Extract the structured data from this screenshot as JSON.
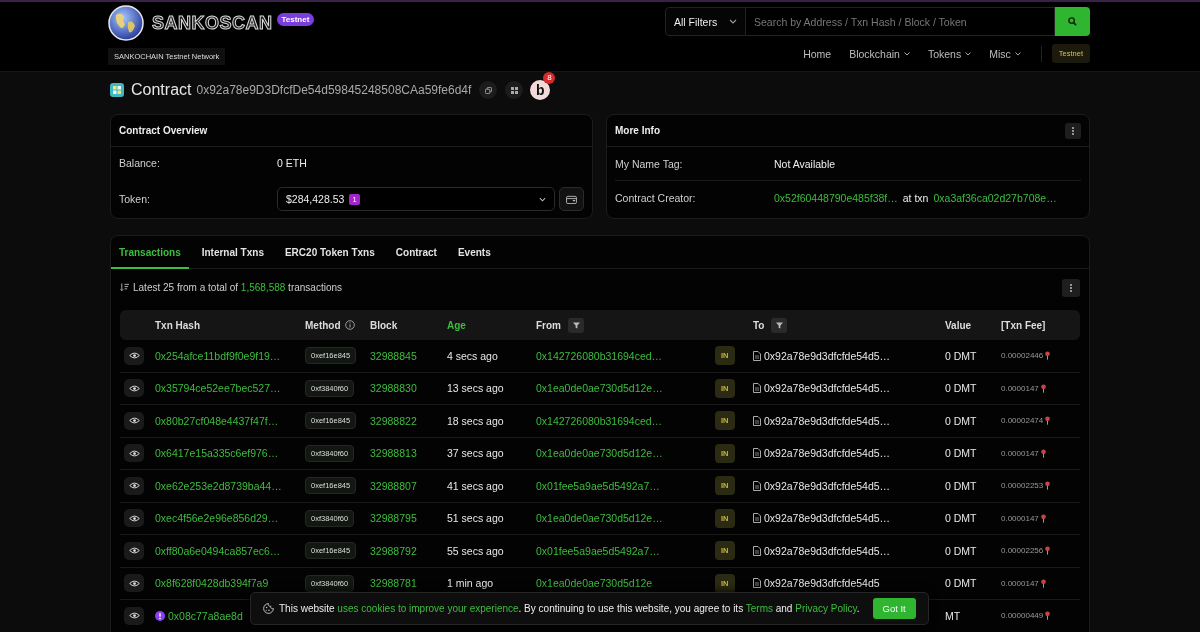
{
  "header": {
    "brand": "SANKOSCAN",
    "brand_badge": "Testnet",
    "network": "SANKOCHAIN Testnet Network",
    "search": {
      "filter": "All Filters",
      "placeholder": "Search by Address / Txn Hash / Block / Token"
    },
    "nav": [
      {
        "label": "Home",
        "kind": "link"
      },
      {
        "label": "Blockchain",
        "kind": "dropdown"
      },
      {
        "label": "Tokens",
        "kind": "dropdown"
      },
      {
        "label": "Misc",
        "kind": "dropdown"
      }
    ],
    "network_button": "Testnet"
  },
  "contract": {
    "title": "Contract",
    "address": "0x92a78e9D3DfcfDe54d59845248508CAa59fe6d4f",
    "avatar_letter": "b",
    "avatar_badge": "8"
  },
  "overview": {
    "title": "Contract Overview",
    "balance_label": "Balance:",
    "balance": "0 ETH",
    "token_label": "Token:",
    "token_value": "$284,428.53",
    "token_count": "1"
  },
  "more_info": {
    "title": "More Info",
    "name_tag_label": "My Name Tag:",
    "name_tag": "Not Available",
    "creator_label": "Contract Creator:",
    "creator": "0x52f60448790e485f38f…",
    "at_txn": "at txn",
    "creator_txn": "0xa3af36ca02d27b708e…"
  },
  "tabs": [
    {
      "label": "Transactions",
      "selected": true
    },
    {
      "label": "Internal Txns",
      "selected": false
    },
    {
      "label": "ERC20 Token Txns",
      "selected": false
    },
    {
      "label": "Contract",
      "selected": false
    },
    {
      "label": "Events",
      "selected": false
    }
  ],
  "summary": {
    "before": "Latest 25 from a total of ",
    "link": "1,568,588",
    "after": " transactions"
  },
  "table": {
    "columns": [
      {
        "label": "Txn Hash",
        "kind": "plain"
      },
      {
        "label": "Method",
        "kind": "info"
      },
      {
        "label": "Block",
        "kind": "plain"
      },
      {
        "label": "Age",
        "kind": "link"
      },
      {
        "label": "From",
        "kind": "filter"
      },
      {
        "label": "To",
        "kind": "filter"
      },
      {
        "label": "Value",
        "kind": "plain"
      },
      {
        "label": "[Txn Fee]",
        "kind": "plain"
      }
    ],
    "rows": [
      {
        "warning": false,
        "hash": "0x254afce11bdf9f0e9f19…",
        "method": "0xef16e845",
        "block": "32988845",
        "age": "4 secs ago",
        "from": "0x142726080b31694ced…",
        "direction": "IN",
        "to": "0x92a78e9d3dfcfde54d5…",
        "value": "0 DMT",
        "fee": "0.00002446"
      },
      {
        "warning": false,
        "hash": "0x35794ce52ee7bec527…",
        "method": "0xf3840f60",
        "block": "32988830",
        "age": "13 secs ago",
        "from": "0x1ea0de0ae730d5d12e…",
        "direction": "IN",
        "to": "0x92a78e9d3dfcfde54d5…",
        "value": "0 DMT",
        "fee": "0.0000147"
      },
      {
        "warning": false,
        "hash": "0x80b27cf048e4437f47f…",
        "method": "0xef16e845",
        "block": "32988822",
        "age": "18 secs ago",
        "from": "0x142726080b31694ced…",
        "direction": "IN",
        "to": "0x92a78e9d3dfcfde54d5…",
        "value": "0 DMT",
        "fee": "0.00002474"
      },
      {
        "warning": false,
        "hash": "0x6417e15a335c6ef976…",
        "method": "0xf3840f60",
        "block": "32988813",
        "age": "37 secs ago",
        "from": "0x1ea0de0ae730d5d12e…",
        "direction": "IN",
        "to": "0x92a78e9d3dfcfde54d5…",
        "value": "0 DMT",
        "fee": "0.0000147"
      },
      {
        "warning": false,
        "hash": "0xe62e253e2d8739ba44…",
        "method": "0xef16e845",
        "block": "32988807",
        "age": "41 secs ago",
        "from": "0x01fee5a9ae5d5492a7…",
        "direction": "IN",
        "to": "0x92a78e9d3dfcfde54d5…",
        "value": "0 DMT",
        "fee": "0.00002253"
      },
      {
        "warning": false,
        "hash": "0xec4f56e2e96e856d29…",
        "method": "0xf3840f60",
        "block": "32988795",
        "age": "51 secs ago",
        "from": "0x1ea0de0ae730d5d12e…",
        "direction": "IN",
        "to": "0x92a78e9d3dfcfde54d5…",
        "value": "0 DMT",
        "fee": "0.0000147"
      },
      {
        "warning": false,
        "hash": "0xff80a6e0494ca857ec6…",
        "method": "0xef16e845",
        "block": "32988792",
        "age": "55 secs ago",
        "from": "0x01fee5a9ae5d5492a7…",
        "direction": "IN",
        "to": "0x92a78e9d3dfcfde54d5…",
        "value": "0 DMT",
        "fee": "0.00002256"
      },
      {
        "warning": false,
        "hash": "0x8f628f0428db394f7a9",
        "method": "0xf3840f60",
        "block": "32988781",
        "age": "1 min ago",
        "from": "0x1ea0de0ae730d5d12e",
        "direction": "IN",
        "to": "0x92a78e9d3dfcfde54d5",
        "value": "0 DMT",
        "fee": "0.0000147"
      },
      {
        "warning": true,
        "hash": "0x08c77a8ae8d",
        "value": "MT",
        "fee": "0.00000449"
      }
    ]
  },
  "cookie_banner": {
    "parts": [
      {
        "text": "This website ",
        "kind": "text"
      },
      {
        "text": "uses cookies to improve your experience",
        "kind": "link"
      },
      {
        "text": ". By continuing to use this website, you agree to its ",
        "kind": "text"
      },
      {
        "text": "Terms",
        "kind": "link"
      },
      {
        "text": " and ",
        "kind": "text"
      },
      {
        "text": "Privacy Policy",
        "kind": "link"
      },
      {
        "text": ".",
        "kind": "text"
      }
    ],
    "button": "Got It"
  }
}
